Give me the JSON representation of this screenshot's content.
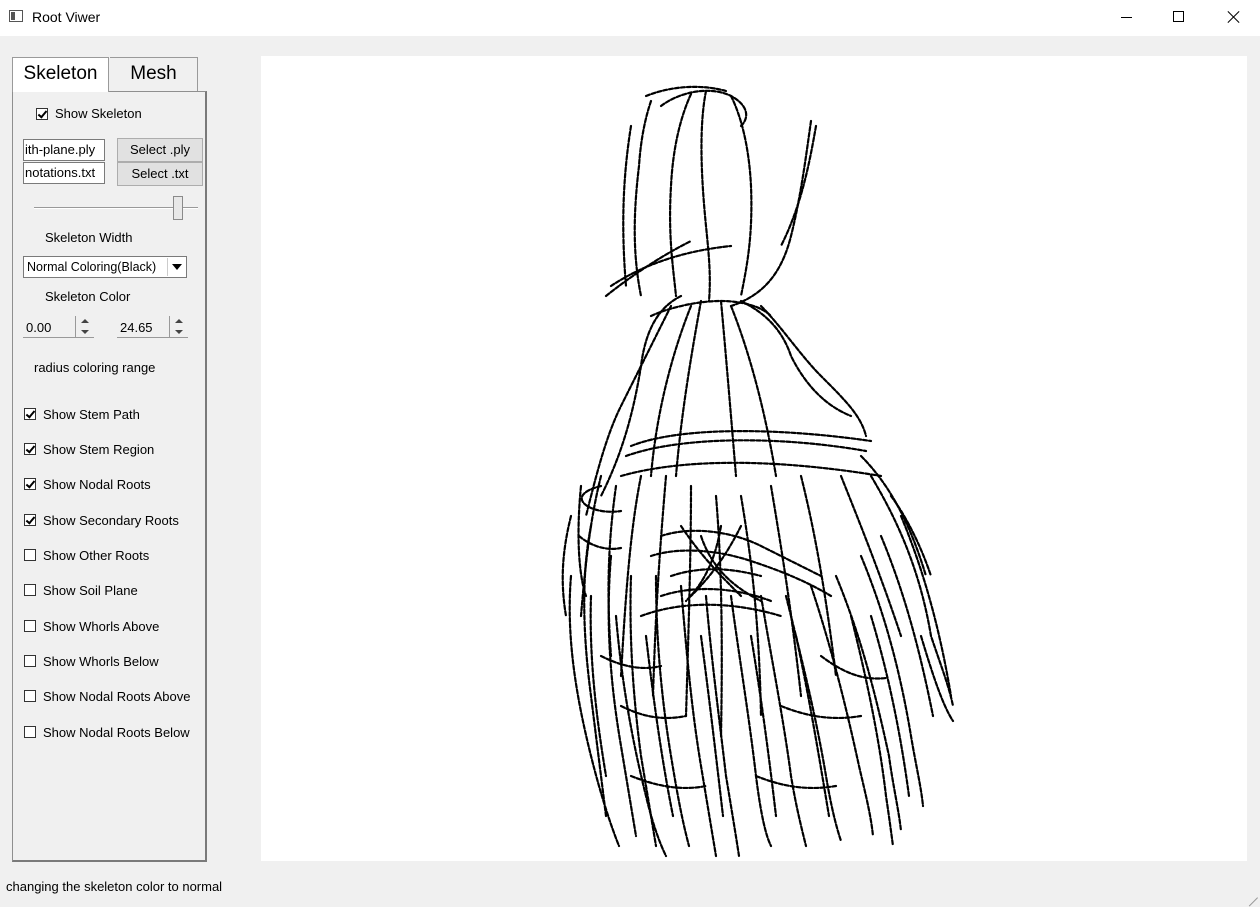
{
  "window": {
    "title": "Root Viwer"
  },
  "tabs": [
    {
      "label": "Skeleton",
      "active": true
    },
    {
      "label": "Mesh",
      "active": false
    }
  ],
  "skeleton_panel": {
    "show_skeleton": {
      "label": "Show Skeleton",
      "checked": true
    },
    "ply_file": {
      "value": "ith-plane.ply",
      "button": "Select .ply"
    },
    "txt_file": {
      "value": "notations.txt",
      "button": "Select .txt"
    },
    "skeleton_width": {
      "label": "Skeleton Width",
      "slider_fraction": 0.88
    },
    "skeleton_color": {
      "label": "Skeleton Color",
      "selected": "Normal Coloring(Black)"
    },
    "radius_range": {
      "min": "0.00",
      "max": "24.65",
      "label": "radius coloring range"
    },
    "checkboxes": [
      {
        "label": "Show Stem Path",
        "checked": true
      },
      {
        "label": "Show Stem Region",
        "checked": true
      },
      {
        "label": "Show Nodal Roots",
        "checked": true
      },
      {
        "label": "Show Secondary Roots",
        "checked": true
      },
      {
        "label": "Show Other Roots",
        "checked": false
      },
      {
        "label": "Show Soil Plane",
        "checked": false
      },
      {
        "label": "Show Whorls Above",
        "checked": false
      },
      {
        "label": "Show Whorls Below",
        "checked": false
      },
      {
        "label": "Show Nodal Roots Above",
        "checked": false
      },
      {
        "label": "Show Nodal Roots Below",
        "checked": false
      }
    ]
  },
  "viewport": {
    "content": "root-skeleton-render",
    "stroke_color": "#000000",
    "background": "#ffffff"
  },
  "status": {
    "message": "changing the skeleton color to normal"
  }
}
